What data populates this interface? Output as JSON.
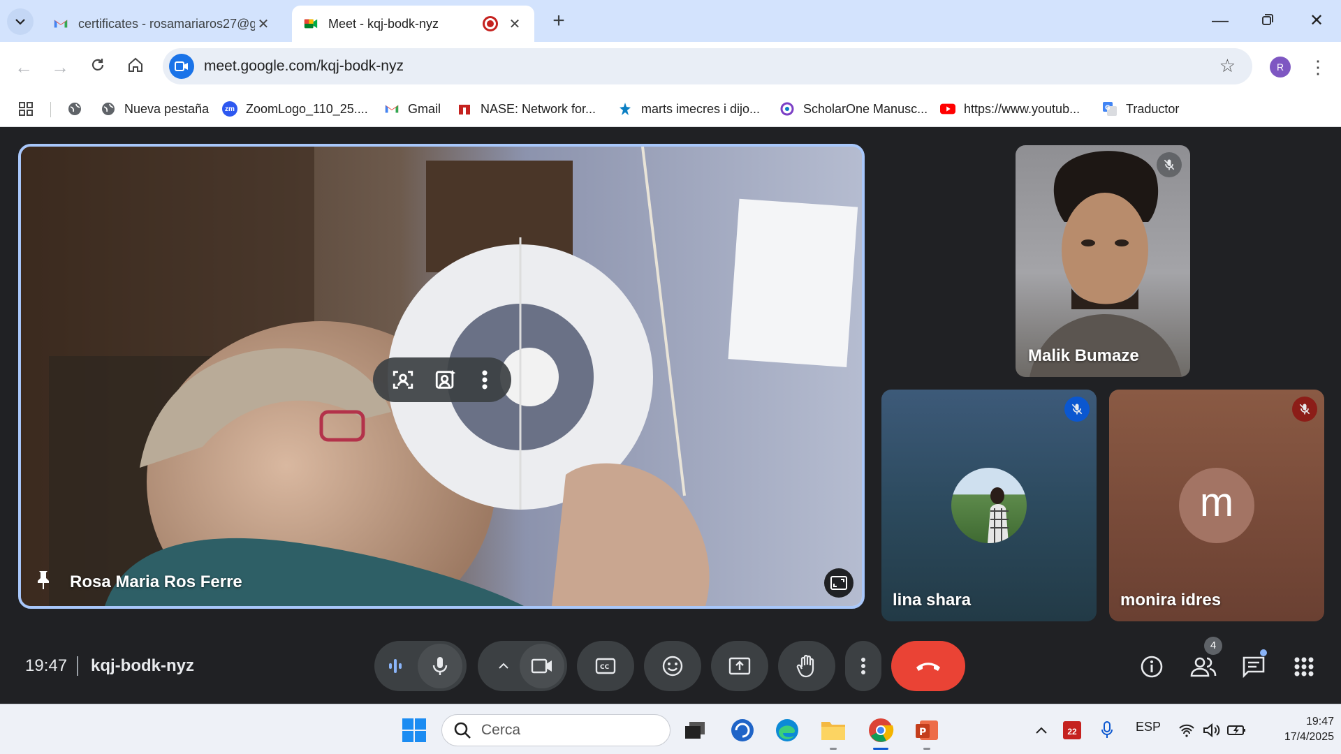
{
  "tabs": [
    {
      "title": "certificates - rosamariaros27@gmail.com",
      "active": false
    },
    {
      "title": "Meet - kqj-bodk-nyz",
      "active": true
    }
  ],
  "address_bar": {
    "url": "meet.google.com/kqj-bodk-nyz"
  },
  "profile_initial": "R",
  "bookmarks": [
    {
      "label": "Nueva pestaña"
    },
    {
      "label": "ZoomLogo_110_25...."
    },
    {
      "label": "Gmail"
    },
    {
      "label": "NASE: Network for..."
    },
    {
      "label": "marts imecres i dijo..."
    },
    {
      "label": "ScholarOne Manusc..."
    },
    {
      "label": "https://www.youtub..."
    },
    {
      "label": "Traductor"
    }
  ],
  "participants": {
    "pinned": {
      "name": "Rosa Maria Ros Ferre"
    },
    "tile1": {
      "name": "Malik Bumaze"
    },
    "tile2": {
      "name": "lina shara"
    },
    "tile3": {
      "name": "monira idres",
      "initial": "m"
    }
  },
  "meeting": {
    "time": "19:47",
    "code": "kqj-bodk-nyz",
    "people_count": "4"
  },
  "taskbar": {
    "search_placeholder": "Cerca",
    "language": "ESP",
    "clock_time": "19:47",
    "clock_date": "17/4/2025",
    "calendar_day": "22"
  }
}
